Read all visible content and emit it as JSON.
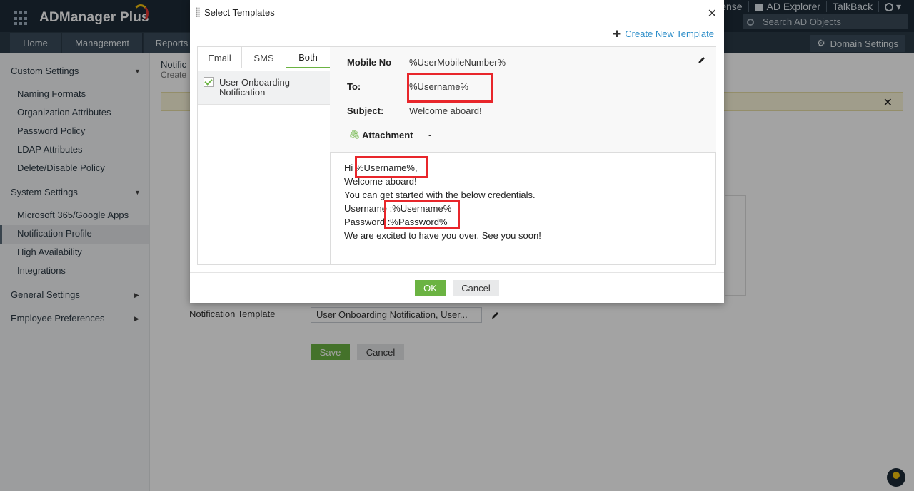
{
  "app": {
    "name": "ADManager Plus"
  },
  "topbar": {
    "links": [
      "ense",
      "AD Explorer",
      "TalkBack"
    ],
    "search_placeholder": "Search AD Objects"
  },
  "navbar": {
    "tabs": [
      "Home",
      "Management",
      "Reports"
    ],
    "domain_settings": "Domain Settings"
  },
  "sidebar": {
    "custom_settings": {
      "label": "Custom Settings",
      "items": [
        "Naming Formats",
        "Organization Attributes",
        "Password Policy",
        "LDAP Attributes",
        "Delete/Disable Policy"
      ]
    },
    "system_settings": {
      "label": "System Settings",
      "items": [
        "Microsoft 365/Google Apps",
        "Notification Profile",
        "High Availability",
        "Integrations"
      ]
    },
    "general_settings": "General Settings",
    "employee_preferences": "Employee Preferences"
  },
  "main": {
    "title": "Notific",
    "subtitle": "Create",
    "notification_template_label": "Notification Template",
    "notification_template_value": "User Onboarding Notification, User...",
    "save": "Save",
    "cancel": "Cancel"
  },
  "modal": {
    "title": "Select Templates",
    "create_new": "Create New Template",
    "tabs": [
      "Email",
      "SMS",
      "Both"
    ],
    "active_tab": "Both",
    "template_item": "User Onboarding Notification",
    "details": {
      "mobile_label": "Mobile No",
      "mobile_value": "%UserMobileNumber%",
      "to_label": "To:",
      "to_value": "%Username%",
      "subject_label": "Subject:",
      "subject_value": "Welcome aboard!",
      "attachment_label": "Attachment",
      "attachment_value": "-"
    },
    "body": [
      "Hi %Username%,",
      "Welcome aboard!",
      "You can get started with the below credentials.",
      "Username :%Username%",
      "Password :%Password%",
      "We are excited to have you over. See you soon!"
    ],
    "ok": "OK",
    "cancel": "Cancel"
  },
  "colors": {
    "accent_green": "#6bb342",
    "link_blue": "#2d8ec9",
    "highlight_red": "#e8262b",
    "topbar": "#1d2b38"
  }
}
